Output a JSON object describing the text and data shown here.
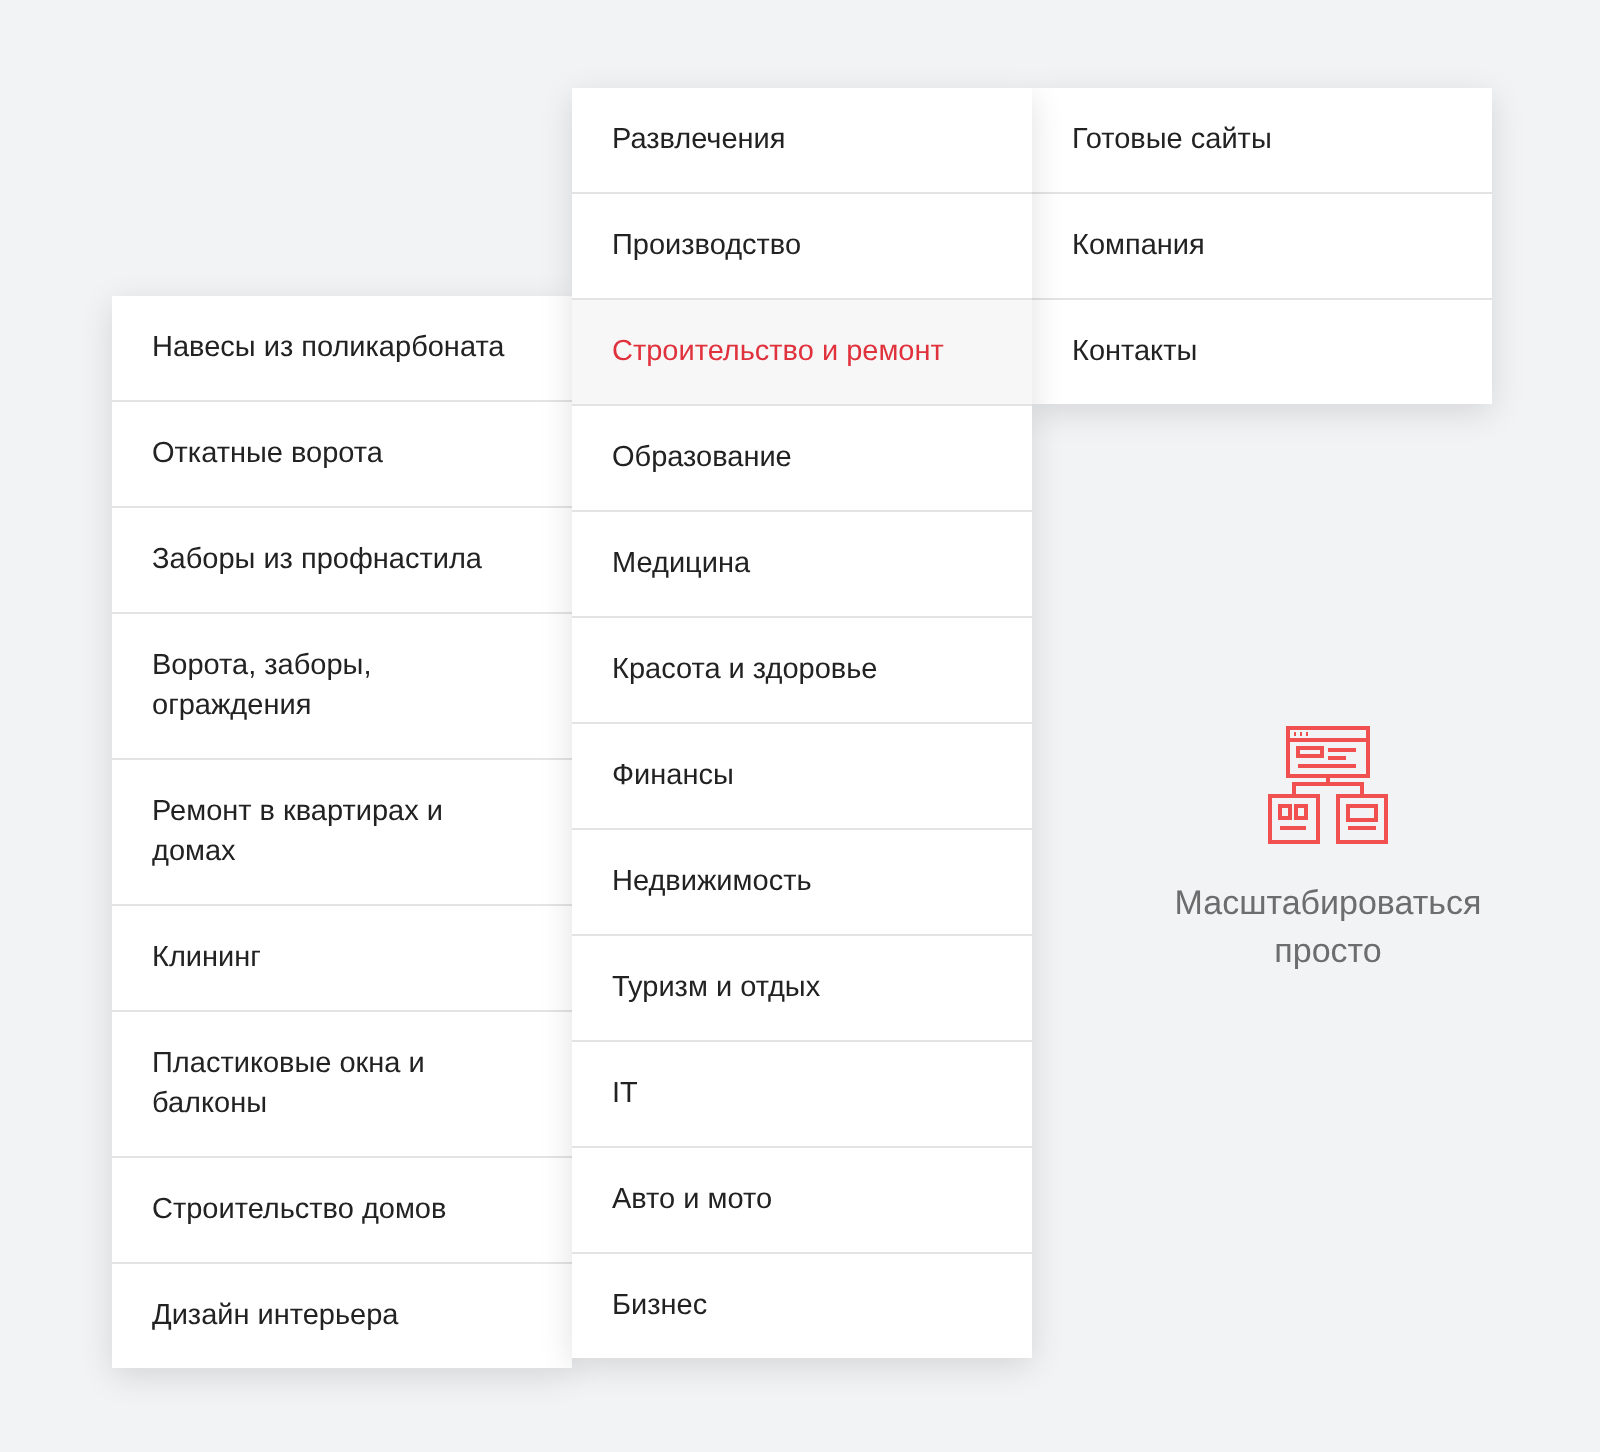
{
  "menus": [
    {
      "items": [
        {
          "label": "Навесы из поликарбоната",
          "selected": false
        },
        {
          "label": "Откатные ворота",
          "selected": false
        },
        {
          "label": "Заборы из профнастила",
          "selected": false
        },
        {
          "label": "Ворота, заборы, ограждения",
          "selected": false
        },
        {
          "label": "Ремонт в квартирах и домах",
          "selected": false
        },
        {
          "label": "Клининг",
          "selected": false
        },
        {
          "label": "Пластиковые окна и балконы",
          "selected": false
        },
        {
          "label": "Строительство домов",
          "selected": false
        },
        {
          "label": "Дизайн интерьера",
          "selected": false
        }
      ]
    },
    {
      "items": [
        {
          "label": "Развлечения",
          "selected": false
        },
        {
          "label": "Производство",
          "selected": false
        },
        {
          "label": "Строительство и ремонт",
          "selected": true
        },
        {
          "label": "Образование",
          "selected": false
        },
        {
          "label": "Медицина",
          "selected": false
        },
        {
          "label": "Красота и здоровье",
          "selected": false
        },
        {
          "label": "Финансы",
          "selected": false
        },
        {
          "label": "Недвижимость",
          "selected": false
        },
        {
          "label": "Туризм и отдых",
          "selected": false
        },
        {
          "label": "IT",
          "selected": false
        },
        {
          "label": "Авто и мото",
          "selected": false
        },
        {
          "label": "Бизнес",
          "selected": false
        }
      ]
    },
    {
      "items": [
        {
          "label": "Готовые сайты",
          "selected": false
        },
        {
          "label": "Компания",
          "selected": false
        },
        {
          "label": "Контакты",
          "selected": false
        }
      ]
    }
  ],
  "feature": {
    "caption": "Масштабироваться просто"
  }
}
